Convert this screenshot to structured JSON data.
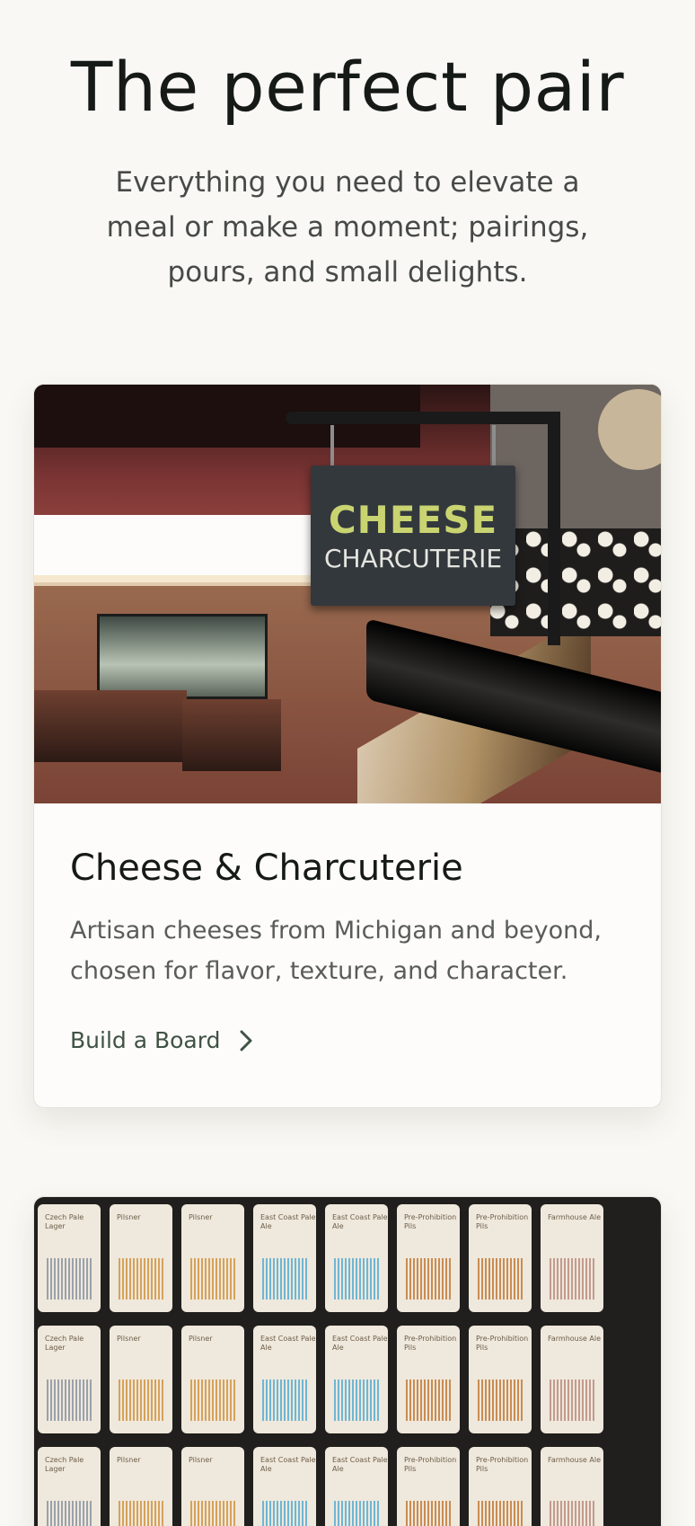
{
  "hero": {
    "title": "The perfect pair",
    "subtitle": "Everything you need to elevate a meal or make a moment; pairings, pours, and small delights."
  },
  "cards": [
    {
      "title": "Cheese & Charcuterie",
      "description": "Artisan cheeses from Michigan and beyond, chosen for flavor, texture, and character.",
      "link_label": "Build a Board",
      "image_sign": {
        "line1": "CHEESE",
        "line2": "CHARCUTERIE"
      }
    },
    {
      "image_can_labels": [
        "Czech Pale Lager",
        "Pilsner",
        "Pilsner",
        "East Coast Pale Ale",
        "East Coast Pale Ale",
        "Pre-Prohibition Pils",
        "Pre-Prohibition Pils",
        "Farmhouse Ale"
      ]
    }
  ],
  "colors": {
    "background": "#f9f8f4",
    "link": "#3f5243",
    "card": "#fdfcfa"
  },
  "icons": {
    "link_icon": "chevron-right-icon"
  }
}
